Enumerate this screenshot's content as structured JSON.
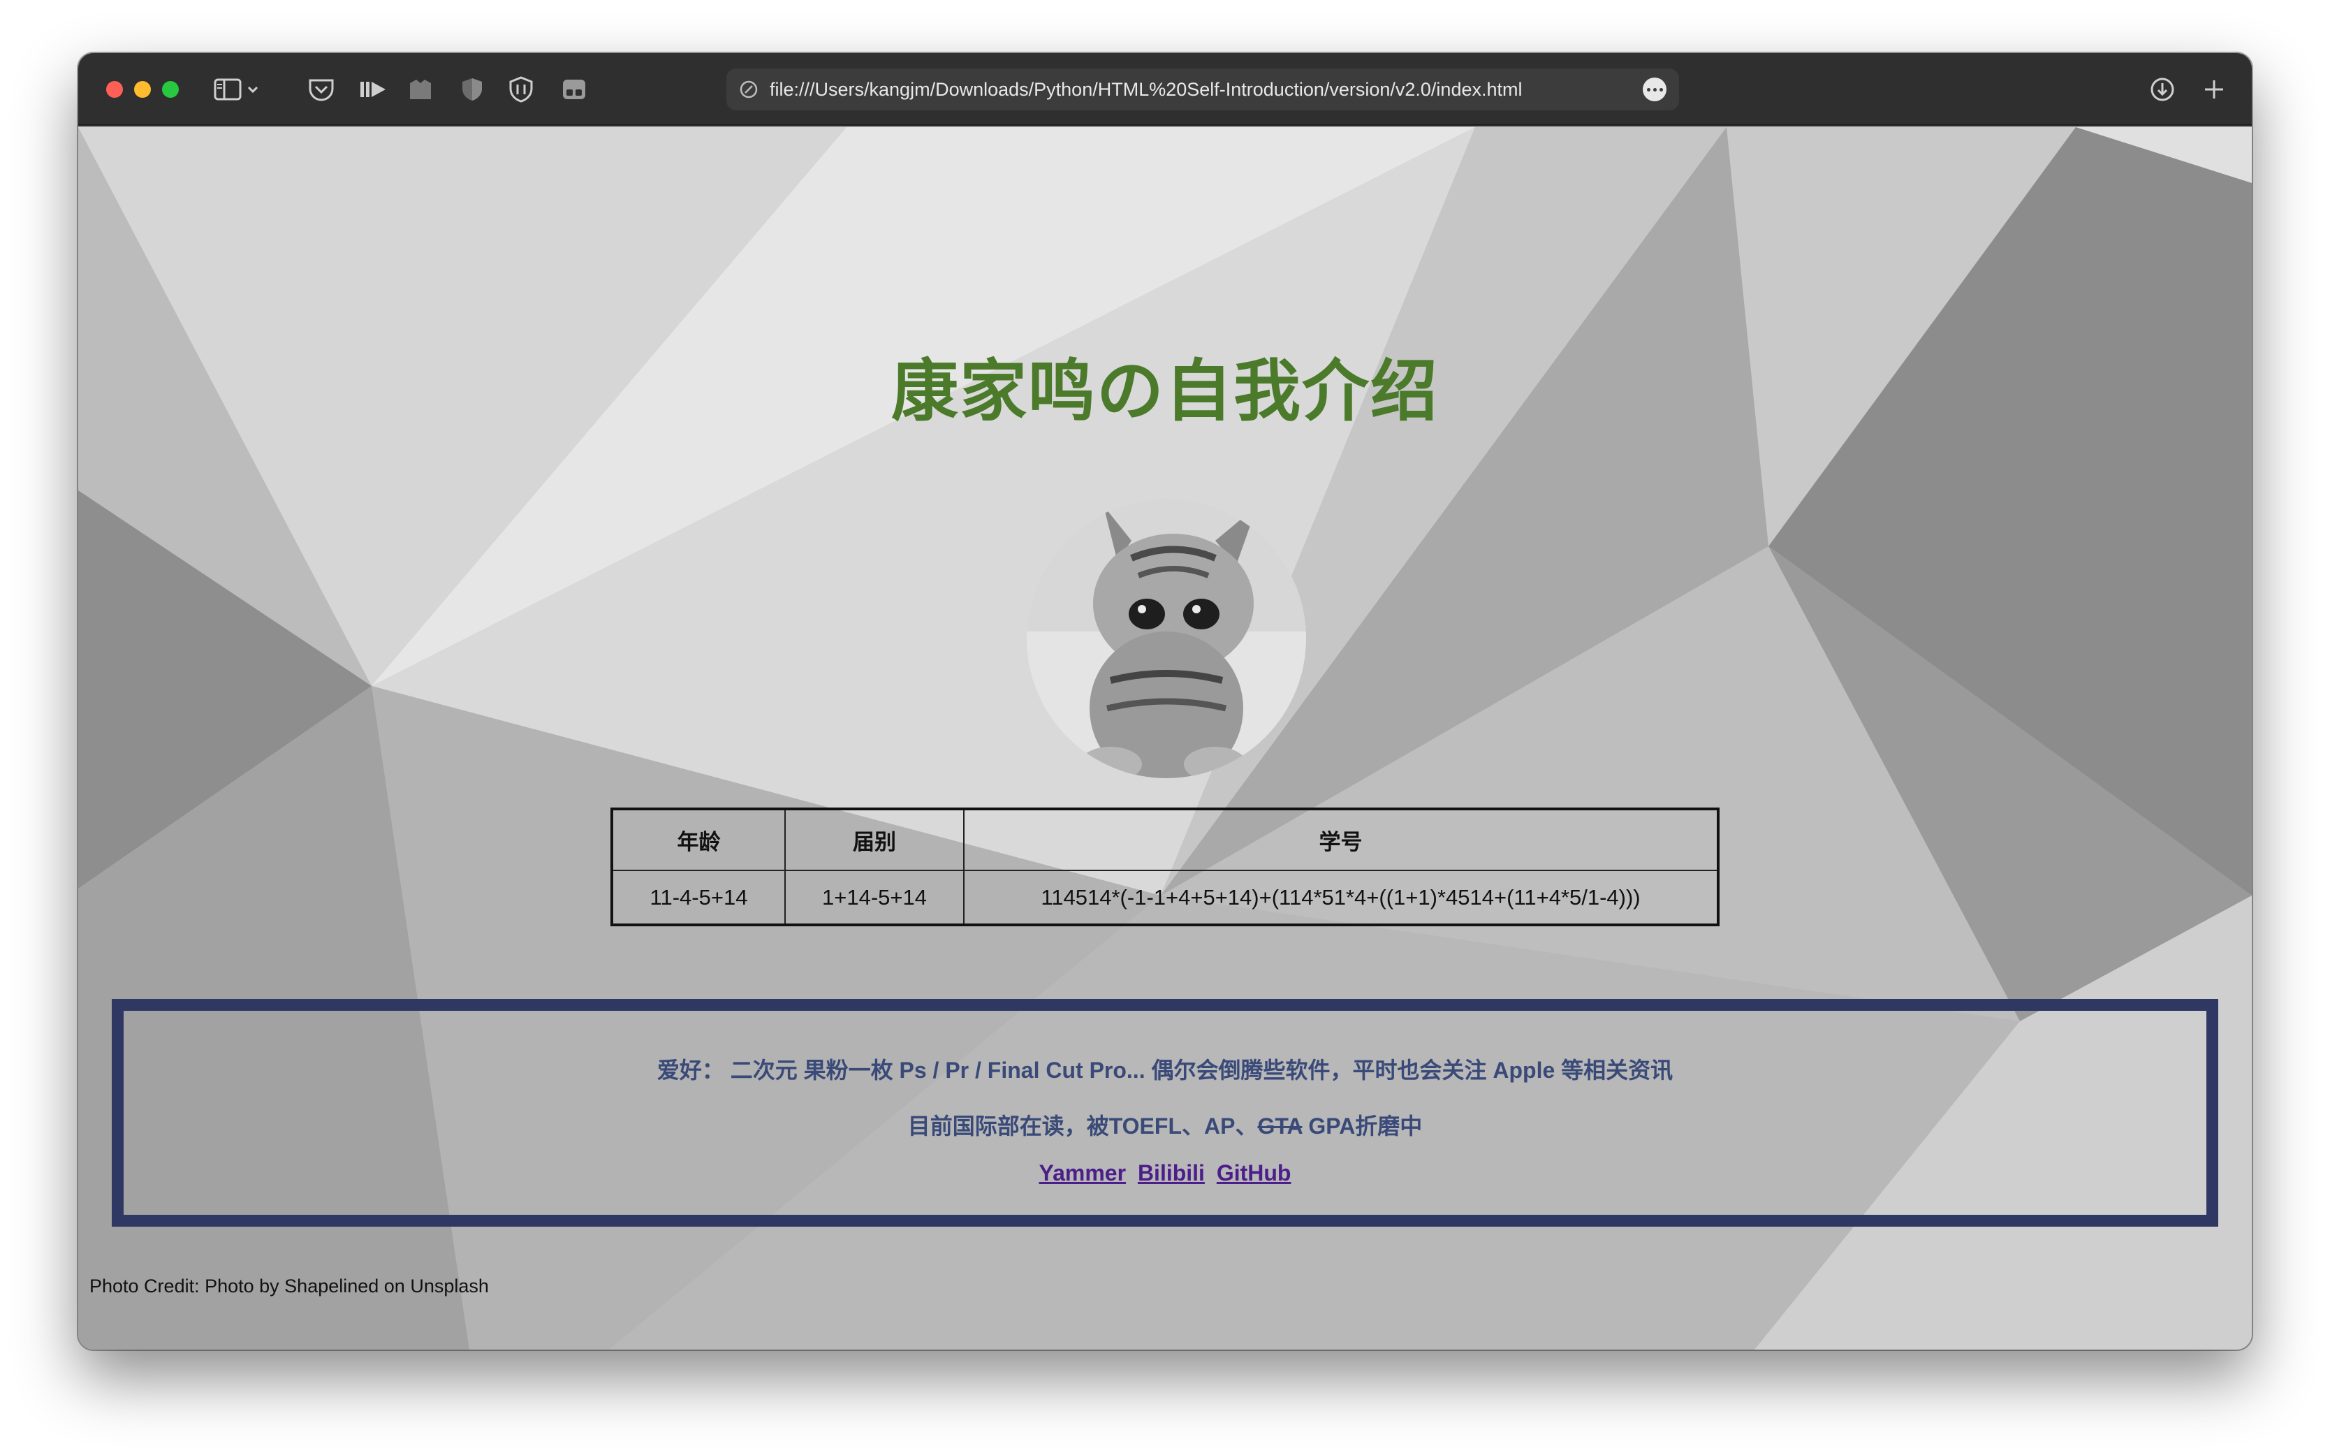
{
  "browser": {
    "url": "file:///Users/kangjm/Downloads/Python/HTML%20Self-Introduction/version/v2.0/index.html"
  },
  "page": {
    "title": "康家鸣の自我介绍",
    "title_color": "#4a7a2a",
    "table": {
      "headers": [
        "年龄",
        "届别",
        "学号"
      ],
      "values": [
        "11-4-5+14",
        "1+14-5+14",
        "114514*(-1-1+4+5+14)+(114*51*4+((1+1)*4514+(11+4*5/1-4)))"
      ]
    },
    "hobbies": "爱好： 二次元 果粉一枚 Ps / Pr / Final Cut Pro... 偶尔会倒腾些软件，平时也会关注 Apple 等相关资讯",
    "study": {
      "prefix": "目前国际部在读，被TOEFL、AP、",
      "struck": "GTA",
      "suffix": " GPA折磨中"
    },
    "links": [
      "Yammer",
      "Bilibili",
      "GitHub"
    ],
    "box_border_color": "#2f3862",
    "photo_credit": "Photo Credit: Photo by Shapelined on Unsplash"
  },
  "icons": {
    "toolbar": [
      "sidebar-icon",
      "chevron-down-icon",
      "pocket-icon",
      "reader-icon",
      "extension-icon",
      "shield-icon",
      "privacy-shield-icon",
      "tabs-icon"
    ],
    "right": [
      "download-icon",
      "new-tab-icon"
    ]
  }
}
